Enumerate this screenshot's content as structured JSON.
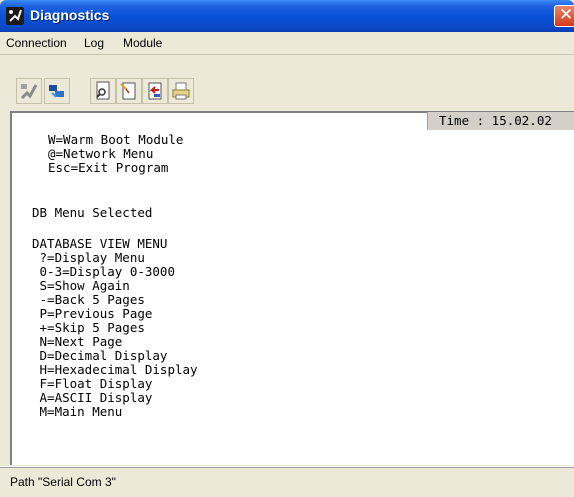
{
  "window": {
    "title": "Diagnostics"
  },
  "menubar": {
    "items": [
      "Connection",
      "Log",
      "Module"
    ]
  },
  "toolbar": {
    "buttons": [
      {
        "icon": "disconnect-icon"
      },
      {
        "icon": "connect-icon"
      },
      {
        "icon": "find-icon"
      },
      {
        "icon": "new-log-icon"
      },
      {
        "icon": "import-icon"
      },
      {
        "icon": "print-icon"
      }
    ]
  },
  "terminal": {
    "time": "Time : 15.02.02",
    "lines": [
      "W=Warm Boot Module",
      "@=Network Menu",
      "Esc=Exit Program",
      "DB Menu Selected",
      "DATABASE VIEW MENU",
      " ?=Display Menu",
      " 0-3=Display 0-3000",
      " S=Show Again",
      " -=Back 5 Pages",
      " P=Previous Page",
      " +=Skip 5 Pages",
      " N=Next Page",
      " D=Decimal Display",
      " H=Hexadecimal Display",
      " F=Float Display",
      " A=ASCII Display",
      " M=Main Menu"
    ]
  },
  "status": {
    "path": "Path \"Serial Com 3\""
  },
  "colors": {
    "titlebar": "#0a52d8",
    "close": "#d6391c",
    "chrome": "#ece9d8"
  }
}
